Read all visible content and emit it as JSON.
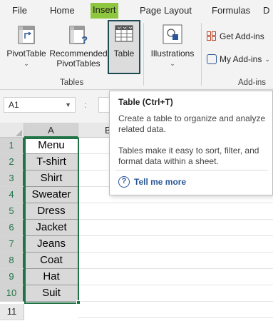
{
  "tabs": [
    "File",
    "Home",
    "Insert",
    "Page Layout",
    "Formulas",
    "D"
  ],
  "active_tab": "Insert",
  "ribbon": {
    "pivottable": "PivotTable",
    "recommended_line1": "Recommended",
    "recommended_line2": "PivotTables",
    "table": "Table",
    "illustrations": "Illustrations",
    "get_addins": "Get Add-ins",
    "my_addins": "My Add-ins",
    "group_tables": "Tables",
    "group_addins": "Add-ins"
  },
  "formula_bar": {
    "name_box": "A1",
    "separator": ":"
  },
  "grid": {
    "columns": [
      "A",
      "B"
    ],
    "rows": [
      "1",
      "2",
      "3",
      "4",
      "5",
      "6",
      "7",
      "8",
      "9",
      "10",
      "11"
    ],
    "cells": [
      "Menu",
      "T-shirt",
      "Shirt",
      "Sweater",
      "Dress",
      "Jacket",
      "Jeans",
      "Coat",
      "Hat",
      "Suit"
    ]
  },
  "tooltip": {
    "title": "Table (Ctrl+T)",
    "desc1": "Create a table to organize and analyze related data.",
    "desc2": "Tables make it easy to sort, filter, and format data within a sheet.",
    "help": "Tell me more"
  },
  "colors": {
    "accent_green": "#217346",
    "active_tab_bg": "#8ec63f",
    "help_blue": "#2b579a"
  }
}
